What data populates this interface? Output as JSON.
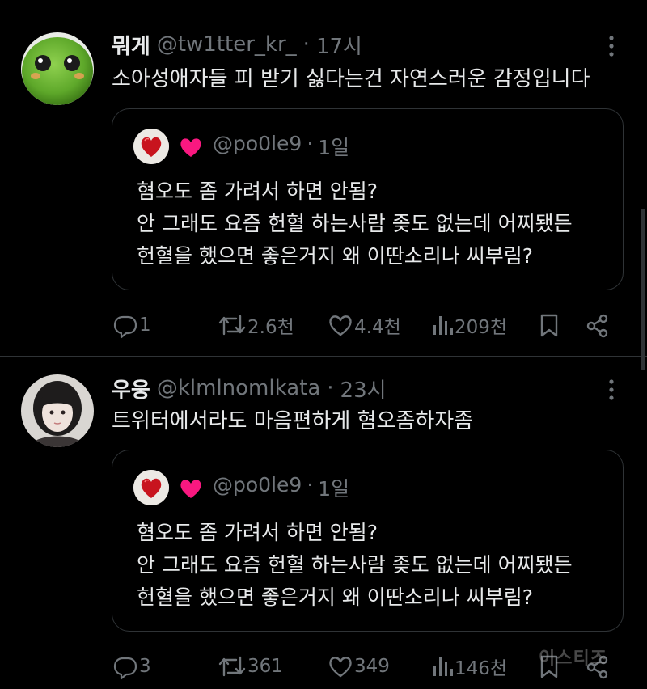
{
  "colors": {
    "background": "#000000",
    "text_primary": "#e7e9ea",
    "text_secondary": "#71767b",
    "border": "#2f3336",
    "heart_accent": "#f91880"
  },
  "tweets": [
    {
      "name": "뭐게",
      "handle": "@tw1tter_kr_",
      "separator": "·",
      "time": "17시",
      "text": "소아성애자들 피 받기 싫다는건 자연스러운 감정입니다",
      "avatar_icon": "green-frog-plush-avatar",
      "quote": {
        "emoji_icon": "red-heart-emoji",
        "handle": "@po0le9",
        "separator": "·",
        "time": "1일",
        "lines": [
          "혐오도 좀 가려서 하면 안됨?",
          "안 그래도 요즘 헌혈 하는사람 좆도 없는데 어찌됐든",
          "헌혈을 했으면 좋은거지 왜 이딴소리나 씨부림?"
        ]
      },
      "stats": {
        "replies": "1",
        "retweets": "2.6천",
        "likes": "4.4천",
        "views": "209천"
      }
    },
    {
      "name": "우웅",
      "handle": "@klmlnomlkata",
      "separator": "·",
      "time": "23시",
      "text": "트위터에서라도 마음편하게 혐오좀하자좀",
      "avatar_icon": "girl-photo-avatar",
      "quote": {
        "emoji_icon": "red-heart-emoji",
        "handle": "@po0le9",
        "separator": "·",
        "time": "1일",
        "lines": [
          "혐오도 좀 가려서 하면 안됨?",
          "안 그래도 요즘 헌혈 하는사람 좆도 없는데 어찌됐든",
          "헌혈을 했으면 좋은거지 왜 이딴소리나 씨부림?"
        ]
      },
      "stats": {
        "replies": "3",
        "retweets": "361",
        "likes": "349",
        "views": "146천"
      }
    }
  ],
  "watermark": "이스티즈"
}
